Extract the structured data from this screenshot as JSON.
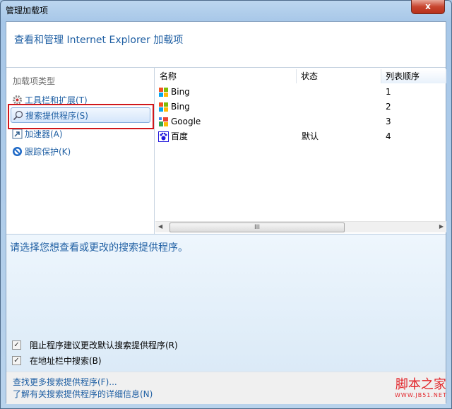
{
  "window": {
    "title": "管理加载项",
    "close": "x"
  },
  "header": {
    "title": "查看和管理 Internet Explorer 加载项"
  },
  "sidebar": {
    "title": "加载项类型",
    "items": [
      {
        "label": "工具栏和扩展(T)",
        "icon": "gear-icon"
      },
      {
        "label": "搜索提供程序(S)",
        "icon": "search-icon",
        "selected": true
      },
      {
        "label": "加速器(A)",
        "icon": "accelerator-icon"
      },
      {
        "label": "跟踪保护(K)",
        "icon": "block-icon"
      }
    ]
  },
  "list": {
    "columns": [
      "名称",
      "状态",
      "列表顺序"
    ],
    "rows": [
      {
        "name": "Bing",
        "status": "",
        "order": "1",
        "icon": "windows-icon"
      },
      {
        "name": "Bing",
        "status": "",
        "order": "2",
        "icon": "windows-icon"
      },
      {
        "name": "Google",
        "status": "",
        "order": "3",
        "icon": "google-icon"
      },
      {
        "name": "百度",
        "status": "默认",
        "order": "4",
        "icon": "baidu-icon"
      }
    ],
    "scroll_grip": "III"
  },
  "details": {
    "prompt": "请选择您想查看或更改的搜索提供程序。",
    "checkboxes": [
      {
        "label": "阻止程序建议更改默认搜索提供程序(R)",
        "checked": true
      },
      {
        "label": "在地址栏中搜索(B)",
        "checked": true
      }
    ]
  },
  "footer": {
    "links": [
      "查找更多搜索提供程序(F)...",
      "了解有关搜索提供程序的详细信息(N)"
    ]
  },
  "watermark": {
    "text": "脚本之家",
    "url": "WWW.JB51.NET"
  }
}
